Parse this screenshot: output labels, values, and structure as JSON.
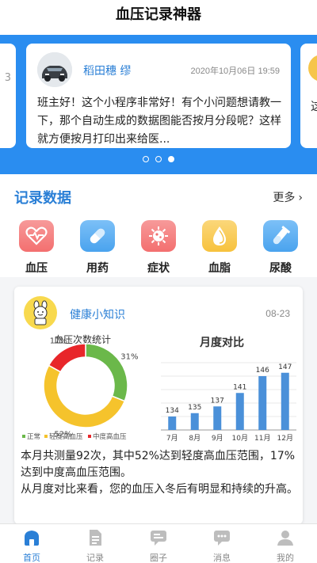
{
  "app": {
    "title": "血压记录神器"
  },
  "banner": {
    "left_fragment": "3",
    "right_fragment": "这",
    "post": {
      "user_name": "稻田穗 缪",
      "time": "2020年10月06日 19:59",
      "message": "班主好！这个小程序非常好！有个小问题想请教一下，那个自动生成的数据图能否按月分段呢？这样就方便按月打印出来给医..."
    },
    "page_index": 3,
    "page_count": 3
  },
  "records": {
    "title": "记录数据",
    "more_label": "更多",
    "categories": [
      {
        "label": "血压",
        "icon": "heart-pulse-icon",
        "color": "#f36f6f"
      },
      {
        "label": "用药",
        "icon": "pill-icon",
        "color": "#4aa3ee"
      },
      {
        "label": "症状",
        "icon": "virus-icon",
        "color": "#f36f6f"
      },
      {
        "label": "血脂",
        "icon": "drop-icon",
        "color": "#f7c23d"
      },
      {
        "label": "尿酸",
        "icon": "test-tube-icon",
        "color": "#4aa3ee"
      }
    ]
  },
  "knowledge": {
    "title": "健康小知识",
    "date": "08-23",
    "summary": "本月共测量92次，其中52%达到轻度高血压范围，17%达到中度高血压范围。\n从月度对比来看，您的血压入冬后有明显和持续的升高。"
  },
  "chart_data": [
    {
      "type": "pie",
      "title": "血压次数统计",
      "series": [
        {
          "name": "正常",
          "value": 31,
          "label": "31%",
          "color": "#6bb84a"
        },
        {
          "name": "轻度高血压",
          "value": 52,
          "label": "52%",
          "color": "#f5c32c"
        },
        {
          "name": "中度高血压",
          "value": 17,
          "label": "17%",
          "color": "#e8262a"
        }
      ]
    },
    {
      "type": "bar",
      "title": "月度对比",
      "categories": [
        "7月",
        "8月",
        "9月",
        "10月",
        "11月",
        "12月"
      ],
      "values": [
        134,
        135,
        137,
        141,
        146,
        147
      ],
      "color": "#4a90d9",
      "grid": true
    }
  ],
  "tabbar": {
    "items": [
      {
        "label": "首页",
        "icon": "home-icon",
        "active": true
      },
      {
        "label": "记录",
        "icon": "record-icon",
        "active": false
      },
      {
        "label": "圈子",
        "icon": "community-icon",
        "active": false
      },
      {
        "label": "消息",
        "icon": "message-icon",
        "active": false
      },
      {
        "label": "我的",
        "icon": "profile-icon",
        "active": false
      }
    ],
    "active_color": "#2a7fd6",
    "inactive_color": "#bdbdbd"
  }
}
